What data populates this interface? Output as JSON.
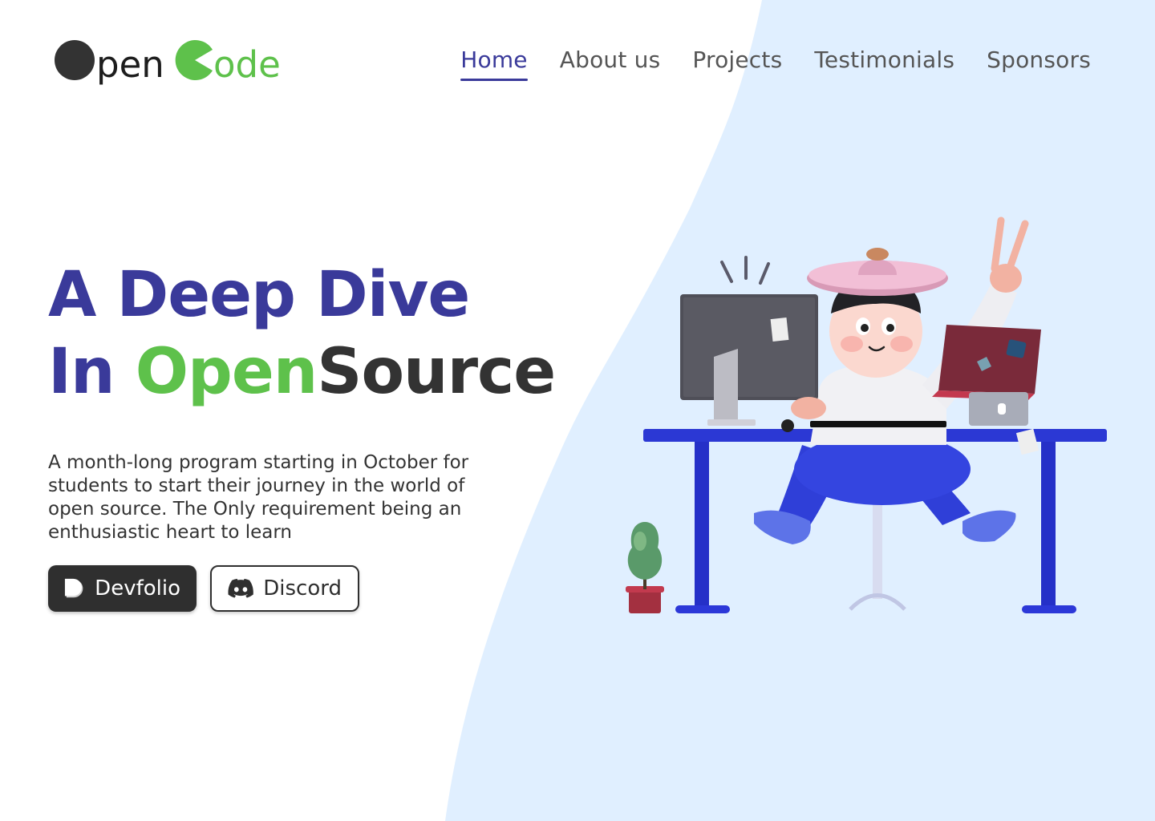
{
  "brand": {
    "logo_text_left": "pen",
    "logo_text_right": "ode",
    "colors": {
      "dark": "#333333",
      "green": "#5ec14b",
      "blue": "#3a3a9a",
      "wave": "#e0efff"
    }
  },
  "nav": {
    "items": [
      {
        "label": "Home",
        "active": true
      },
      {
        "label": "About us",
        "active": false
      },
      {
        "label": "Projects",
        "active": false
      },
      {
        "label": "Testimonials",
        "active": false
      },
      {
        "label": "Sponsors",
        "active": false
      }
    ]
  },
  "hero": {
    "line1": "A Deep Dive",
    "line2_prefix": "In ",
    "line2_highlight": "Open",
    "line2_suffix": "Source",
    "description": "A month-long program starting in October for students to start their journey in the world of open source. The Only requirement being an enthusiastic heart to learn"
  },
  "buttons": {
    "devfolio": {
      "label": "Devfolio",
      "icon": "devfolio-icon"
    },
    "discord": {
      "label": "Discord",
      "icon": "discord-icon"
    }
  },
  "illustration": {
    "subject": "3d-character-at-desk"
  }
}
